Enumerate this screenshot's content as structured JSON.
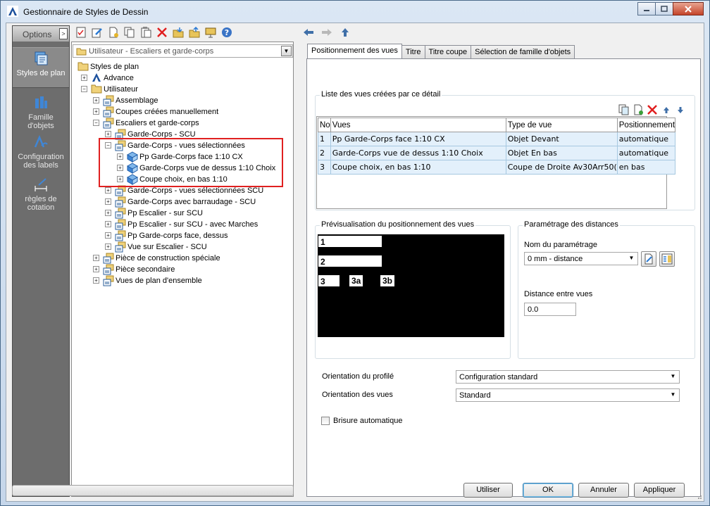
{
  "window": {
    "title": "Gestionnaire de Styles de Dessin",
    "controls": {
      "minimize": "minimize",
      "maximize": "maximize",
      "close": "close"
    }
  },
  "options": {
    "title": "Options",
    "items": [
      {
        "label": "Styles de plan",
        "icon": "plan-styles-icon",
        "active": true
      },
      {
        "label": "Famille d'objets",
        "icon": "object-family-icon",
        "active": false
      },
      {
        "label": "Configuration des labels",
        "icon": "labels-config-icon",
        "active": false
      },
      {
        "label": "règles de cotation",
        "icon": "dimension-rules-icon",
        "active": false
      }
    ]
  },
  "tree": {
    "combo_value": "Utilisateur - Escaliers et garde-corps",
    "nodes": [
      {
        "label": "Styles de plan",
        "level": 0,
        "exp": "",
        "icon": "folder"
      },
      {
        "label": "Advance",
        "level": 1,
        "exp": "+",
        "icon": "advance"
      },
      {
        "label": "Utilisateur",
        "level": 1,
        "exp": "-",
        "icon": "folder"
      },
      {
        "label": "Assemblage",
        "level": 2,
        "exp": "+",
        "icon": "stack"
      },
      {
        "label": "Coupes créées manuellement",
        "level": 2,
        "exp": "+",
        "icon": "stack"
      },
      {
        "label": "Escaliers et garde-corps",
        "level": 2,
        "exp": "-",
        "icon": "stack"
      },
      {
        "label": "Garde-Corps - SCU",
        "level": 3,
        "exp": "+",
        "icon": "stack"
      },
      {
        "label": "Garde-Corps - vues sélectionnées",
        "level": 3,
        "exp": "-",
        "icon": "stack"
      },
      {
        "label": "Pp Garde-Corps face 1:10 CX",
        "level": 4,
        "exp": "+",
        "icon": "view"
      },
      {
        "label": "Garde-Corps vue de dessus 1:10 Choix",
        "level": 4,
        "exp": "+",
        "icon": "view"
      },
      {
        "label": "Coupe choix, en bas 1:10",
        "level": 4,
        "exp": "+",
        "icon": "view"
      },
      {
        "label": "Garde-Corps - vues sélectionnées SCU",
        "level": 3,
        "exp": "+",
        "icon": "stack"
      },
      {
        "label": "Garde-Corps avec barraudage - SCU",
        "level": 3,
        "exp": "+",
        "icon": "stack"
      },
      {
        "label": "Pp Escalier - sur SCU",
        "level": 3,
        "exp": "+",
        "icon": "stack"
      },
      {
        "label": "Pp Escalier - sur SCU - avec Marches",
        "level": 3,
        "exp": "+",
        "icon": "stack"
      },
      {
        "label": "Pp Garde-corps face, dessus",
        "level": 3,
        "exp": "+",
        "icon": "stack"
      },
      {
        "label": "Vue sur Escalier - SCU",
        "level": 3,
        "exp": "+",
        "icon": "stack"
      },
      {
        "label": "Pièce de construction spéciale",
        "level": 2,
        "exp": "+",
        "icon": "stack"
      },
      {
        "label": "Pièce secondaire",
        "level": 2,
        "exp": "+",
        "icon": "stack"
      },
      {
        "label": "Vues de plan d'ensemble",
        "level": 2,
        "exp": "+",
        "icon": "stack"
      }
    ]
  },
  "tabs": [
    "Positionnement des vues",
    "Titre",
    "Titre coupe",
    "Sélection de famille d'objets"
  ],
  "views_group": {
    "title": "Liste des vues créées par ce détail",
    "columns": [
      "No",
      "Vues",
      "Type de vue",
      "Positionnement"
    ],
    "rows": [
      [
        "1",
        "Pp Garde-Corps face 1:10 CX",
        "Objet Devant",
        "automatique"
      ],
      [
        "2",
        "Garde-Corps vue de dessus 1:10 Choix",
        "Objet En bas",
        "automatique"
      ],
      [
        "3",
        "Coupe choix, en bas 1:10",
        "Coupe de Droite Av30Arr50(",
        "en bas"
      ]
    ]
  },
  "preview": {
    "title": "Prévisualisation du positionnement des vues",
    "labels": [
      "1",
      "2",
      "3",
      "3a",
      "3b"
    ]
  },
  "distances": {
    "title": "Paramétrage des distances",
    "name_label": "Nom du paramétrage",
    "name_value": "0 mm - distance",
    "distance_label": "Distance entre vues",
    "distance_value": "0.0"
  },
  "orientation": {
    "profile_label": "Orientation du profilé",
    "profile_value": "Configuration standard",
    "views_label": "Orientation des vues",
    "views_value": "Standard"
  },
  "checkbox": {
    "label": "Brisure automatique",
    "checked": false
  },
  "buttons": {
    "use": "Utiliser",
    "ok": "OK",
    "cancel": "Annuler",
    "apply": "Appliquer"
  },
  "colors": {
    "accent_red": "#e02020",
    "selection_bg": "#e3f0fb"
  }
}
